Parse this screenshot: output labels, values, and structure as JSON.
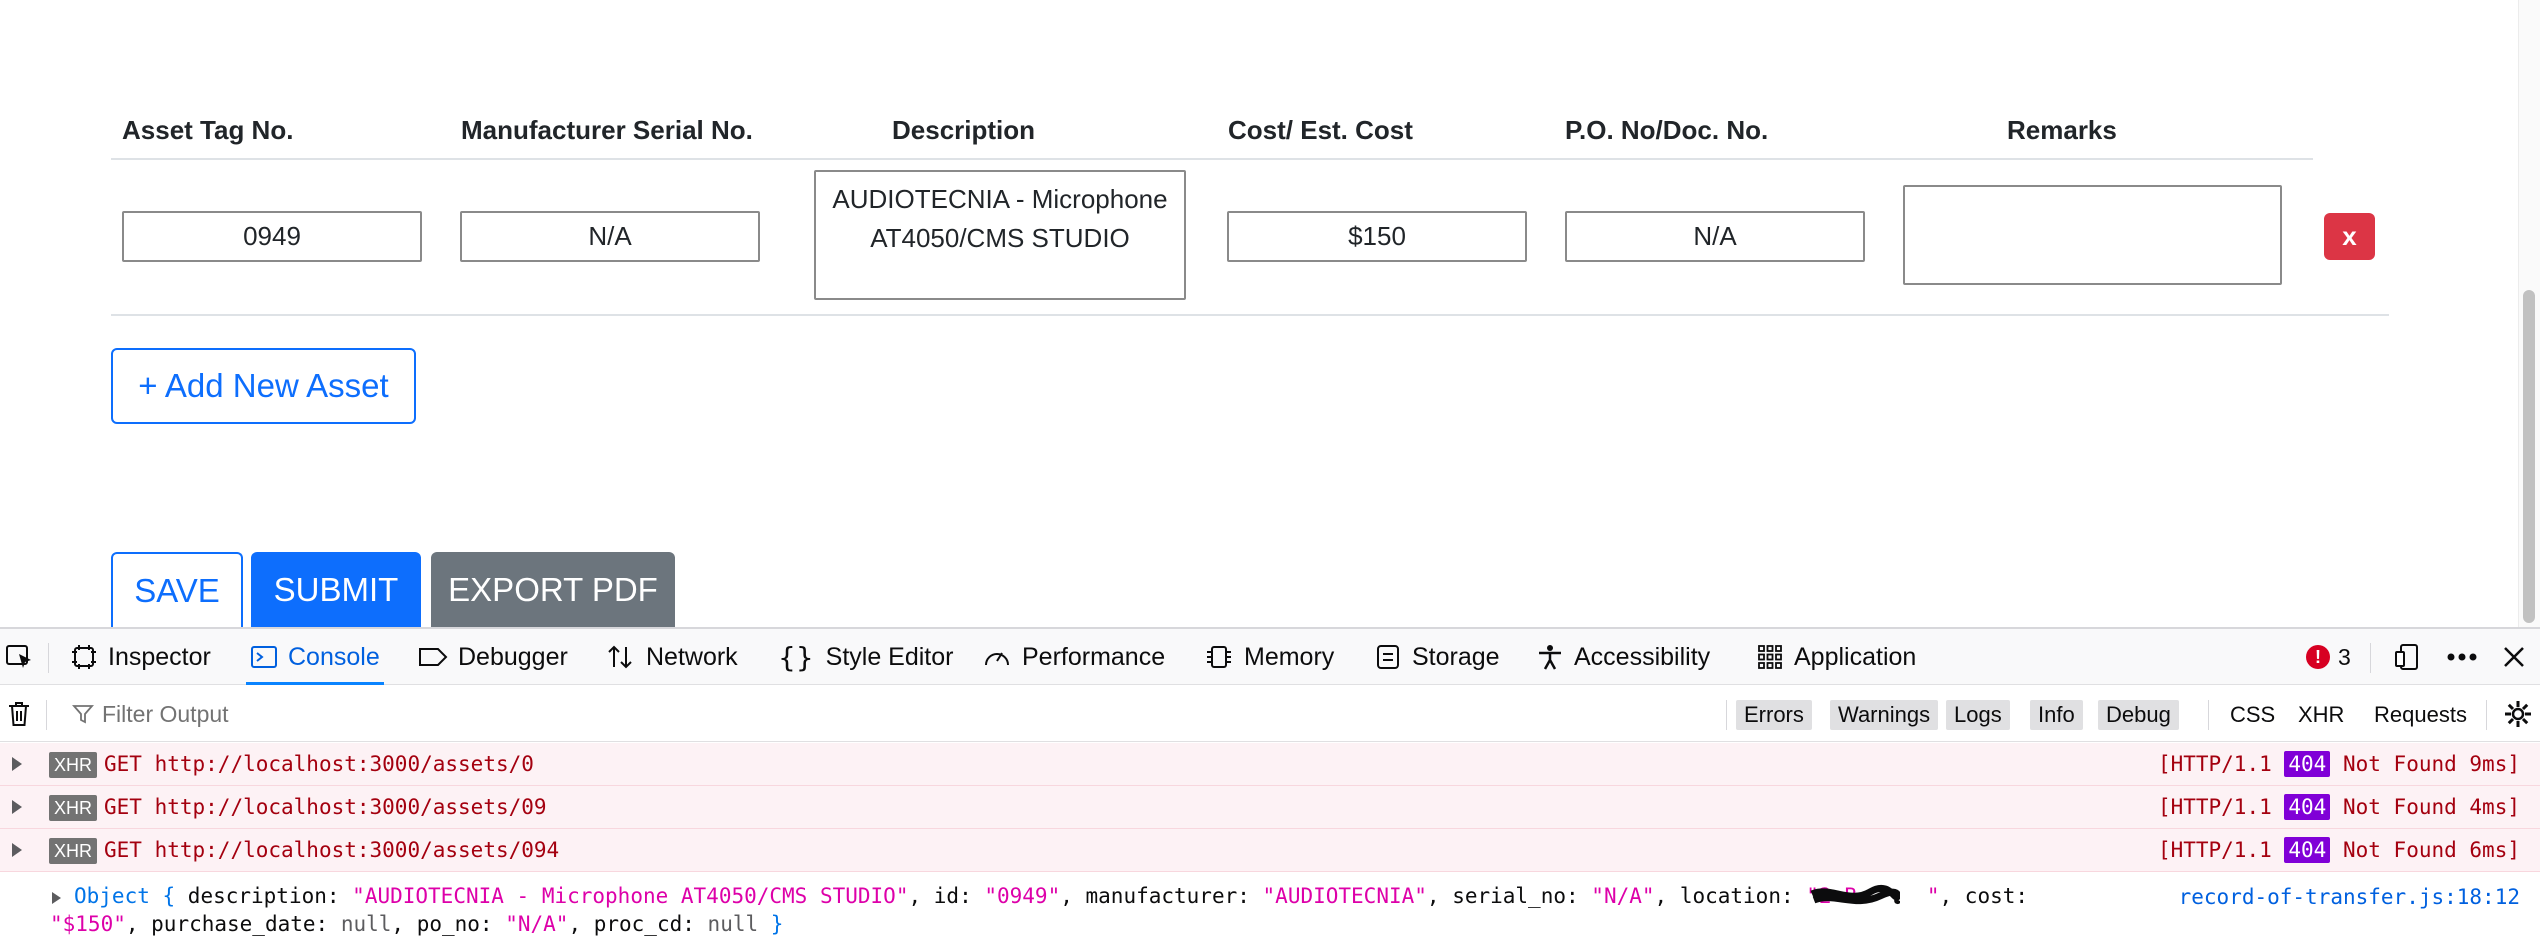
{
  "table": {
    "headers": [
      "Asset Tag No.",
      "Manufacturer Serial No.",
      "Description",
      "Cost/ Est. Cost",
      "P.O. No/Doc. No.",
      "Remarks"
    ],
    "row": {
      "asset_tag": "0949",
      "serial_no": "N/A",
      "description": "AUDIOTECNIA - Microphone\nAT4050/CMS STUDIO",
      "cost": "$150",
      "po_no": "N/A",
      "remarks": "",
      "delete_label": "x"
    }
  },
  "actions": {
    "add_asset": "+ Add New Asset",
    "save": "SAVE",
    "submit": "SUBMIT",
    "export_pdf": "EXPORT PDF"
  },
  "devtools": {
    "tabs": [
      "Inspector",
      "Console",
      "Debugger",
      "Network",
      "Style Editor",
      "Performance",
      "Memory",
      "Storage",
      "Accessibility",
      "Application"
    ],
    "active_tab": "Console",
    "error_count": "3",
    "filter_placeholder": "Filter Output",
    "level_filters": [
      "Errors",
      "Warnings",
      "Logs",
      "Info",
      "Debug"
    ],
    "type_filters": [
      "CSS",
      "XHR",
      "Requests"
    ],
    "logs": [
      {
        "badge": "XHR",
        "method": "GET",
        "url": "http://localhost:3000/assets/0",
        "status_prefix": "[HTTP/1.1",
        "code": "404",
        "status_suffix": "Not Found 9ms]"
      },
      {
        "badge": "XHR",
        "method": "GET",
        "url": "http://localhost:3000/assets/09",
        "status_prefix": "[HTTP/1.1",
        "code": "404",
        "status_suffix": "Not Found 4ms]"
      },
      {
        "badge": "XHR",
        "method": "GET",
        "url": "http://localhost:3000/assets/094",
        "status_prefix": "[HTTP/1.1",
        "code": "404",
        "status_suffix": "Not Found 6ms]"
      }
    ],
    "object_log": {
      "source": "record-of-transfer.js:18:12",
      "line1": {
        "prefix": "Object { ",
        "description_key": "description",
        "description_val": "\"AUDIOTECNIA - Microphone AT4050/CMS STUDIO\"",
        "id_key": "id",
        "id_val": "\"0949\"",
        "manufacturer_key": "manufacturer",
        "manufacturer_val": "\"AUDIOTECNIA\"",
        "serial_key": "serial_no",
        "serial_val": "\"N/A\"",
        "location_key": "location",
        "location_val": "\"2 B",
        "cost_key": "cost"
      },
      "line2": {
        "cost_val": "\"$150\"",
        "purchase_key": "purchase_date",
        "purchase_val": "null",
        "po_key": "po_no",
        "po_val": "\"N/A\"",
        "proc_key": "proc_cd",
        "proc_val": "null",
        "suffix": "}"
      }
    }
  }
}
